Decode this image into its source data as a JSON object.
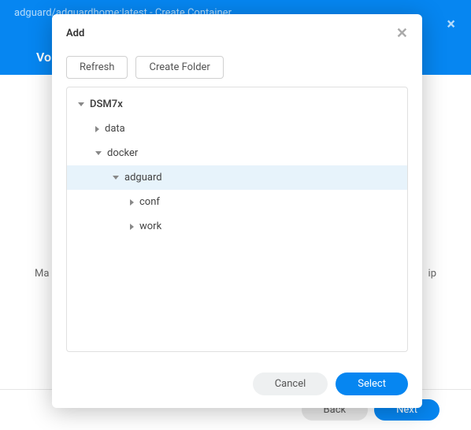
{
  "background": {
    "title": "adguard/adguardhome:latest - Create Container",
    "section": "Vol",
    "left_text": "Ma",
    "right_text": "ip",
    "back": "Back",
    "next": "Next"
  },
  "modal": {
    "title": "Add",
    "refresh": "Refresh",
    "create_folder": "Create Folder",
    "cancel": "Cancel",
    "select": "Select"
  },
  "tree": [
    {
      "label": "DSM7x",
      "level": 0,
      "expanded": true,
      "selected": false,
      "root": true
    },
    {
      "label": "data",
      "level": 1,
      "expanded": false,
      "selected": false
    },
    {
      "label": "docker",
      "level": 1,
      "expanded": true,
      "selected": false
    },
    {
      "label": "adguard",
      "level": 2,
      "expanded": true,
      "selected": true
    },
    {
      "label": "conf",
      "level": 3,
      "expanded": false,
      "selected": false
    },
    {
      "label": "work",
      "level": 3,
      "expanded": false,
      "selected": false
    }
  ]
}
